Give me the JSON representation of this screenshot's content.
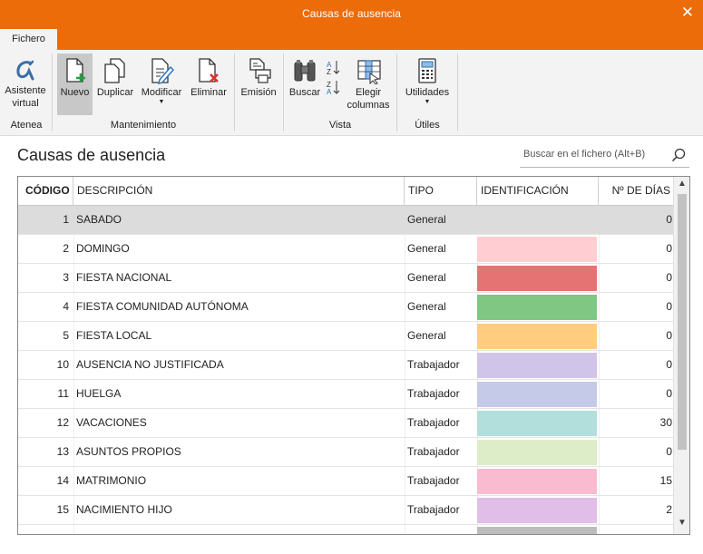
{
  "window": {
    "title": "Causas de ausencia",
    "close_glyph": "✕"
  },
  "tabs": [
    {
      "label": "Fichero",
      "active": true
    }
  ],
  "ribbon": {
    "buttons": [
      {
        "id": "asistente",
        "line1": "Asistente",
        "line2": "virtual",
        "icon": "atenea-alpha-icon"
      },
      {
        "id": "nuevo",
        "label": "Nuevo",
        "icon": "new-document-icon",
        "active": true
      },
      {
        "id": "duplicar",
        "label": "Duplicar",
        "icon": "duplicate-icon"
      },
      {
        "id": "modificar",
        "label": "Modificar",
        "icon": "edit-document-icon",
        "dropdown": true
      },
      {
        "id": "eliminar",
        "label": "Eliminar",
        "icon": "delete-document-icon"
      },
      {
        "id": "emision",
        "label": "Emisión",
        "icon": "print-icon"
      },
      {
        "id": "buscar",
        "label": "Buscar",
        "icon": "binoculars-icon"
      },
      {
        "id": "ordenar",
        "label": "",
        "icon": "sort-icon"
      },
      {
        "id": "elegir",
        "line1": "Elegir",
        "line2": "columnas",
        "icon": "columns-icon"
      },
      {
        "id": "utilidades",
        "label": "Utilidades",
        "icon": "calculator-icon",
        "dropdown": true
      }
    ],
    "groups": [
      "Atenea",
      "Mantenimiento",
      "Vista",
      "Útiles"
    ]
  },
  "page": {
    "heading": "Causas de ausencia"
  },
  "search": {
    "placeholder": "Buscar en el fichero (Alt+B)"
  },
  "table": {
    "columns": [
      "CÓDIGO",
      "DESCRIPCIÓN",
      "TIPO",
      "IDENTIFICACIÓN",
      "Nº DE DÍAS"
    ],
    "rows": [
      {
        "code": "1",
        "desc": "SABADO",
        "tipo": "General",
        "color": "",
        "dias": "0",
        "selected": true
      },
      {
        "code": "2",
        "desc": "DOMINGO",
        "tipo": "General",
        "color": "#ffcdd2",
        "dias": "0"
      },
      {
        "code": "3",
        "desc": "FIESTA NACIONAL",
        "tipo": "General",
        "color": "#e57373",
        "dias": "0"
      },
      {
        "code": "4",
        "desc": "FIESTA COMUNIDAD AUTÓNOMA",
        "tipo": "General",
        "color": "#81c784",
        "dias": "0"
      },
      {
        "code": "5",
        "desc": "FIESTA LOCAL",
        "tipo": "General",
        "color": "#ffcc80",
        "dias": "0"
      },
      {
        "code": "10",
        "desc": "AUSENCIA NO JUSTIFICADA",
        "tipo": "Trabajador",
        "color": "#d1c4e9",
        "dias": "0"
      },
      {
        "code": "11",
        "desc": "HUELGA",
        "tipo": "Trabajador",
        "color": "#c5cae9",
        "dias": "0"
      },
      {
        "code": "12",
        "desc": "VACACIONES",
        "tipo": "Trabajador",
        "color": "#b2dfdb",
        "dias": "30"
      },
      {
        "code": "13",
        "desc": "ASUNTOS PROPIOS",
        "tipo": "Trabajador",
        "color": "#dcedc8",
        "dias": "0"
      },
      {
        "code": "14",
        "desc": "MATRIMONIO",
        "tipo": "Trabajador",
        "color": "#f8bbd0",
        "dias": "15"
      },
      {
        "code": "15",
        "desc": "NACIMIENTO HIJO",
        "tipo": "Trabajador",
        "color": "#e1bee7",
        "dias": "2"
      },
      {
        "code": "",
        "desc": "",
        "tipo": "",
        "color": "#bdbdbd",
        "dias": ""
      }
    ]
  },
  "colors": {
    "accent": "#ec6c0a",
    "ribbon_bg": "#f3f3f3",
    "selected_row": "#dcdcdc"
  }
}
